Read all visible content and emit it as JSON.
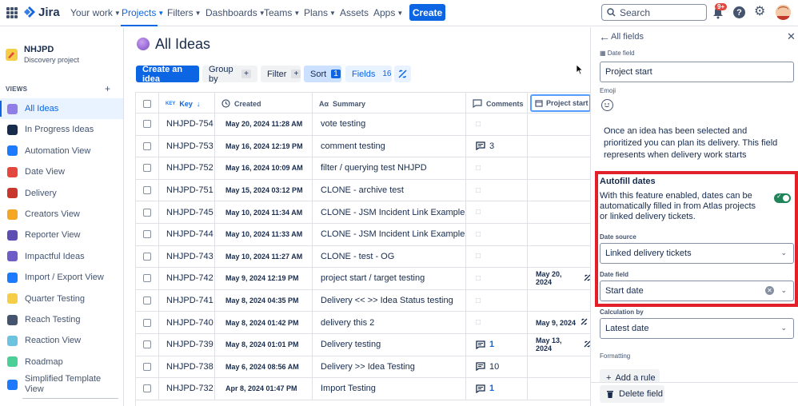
{
  "nav": {
    "logo_text": "Jira",
    "items": [
      "Your work",
      "Projects",
      "Filters",
      "Dashboards",
      "Teams",
      "Plans",
      "Assets",
      "Apps"
    ],
    "create_label": "Create",
    "search_placeholder": "Search",
    "notifications_badge": "9+",
    "help_label": "?"
  },
  "sidebar": {
    "project_name": "NHJPD",
    "project_type": "Discovery project",
    "views_title": "VIEWS",
    "views_add": "+",
    "items": [
      {
        "label": "All Ideas",
        "icon": "crystal-ball-icon",
        "color": "#8f7ee7"
      },
      {
        "label": "In Progress Ideas",
        "icon": "soon-sign-icon",
        "color": "#172b4d"
      },
      {
        "label": "Automation View",
        "icon": "infinity-icon",
        "color": "#1d7afc"
      },
      {
        "label": "Date View",
        "icon": "calendar-icon",
        "color": "#e2483d"
      },
      {
        "label": "Delivery",
        "icon": "truck-icon",
        "color": "#c9372c"
      },
      {
        "label": "Creators View",
        "icon": "person-icon",
        "color": "#f5a623"
      },
      {
        "label": "Reporter View",
        "icon": "pen-icon",
        "color": "#5e4db2"
      },
      {
        "label": "Impactful Ideas",
        "icon": "bar-chart-icon",
        "color": "#6e5dc6"
      },
      {
        "label": "Import / Export View",
        "icon": "arrows-icon",
        "color": "#1d7afc"
      },
      {
        "label": "Quarter Testing",
        "icon": "moon-icon",
        "color": "#f5cd47"
      },
      {
        "label": "Reach Testing",
        "icon": "telescope-icon",
        "color": "#44546f"
      },
      {
        "label": "Reaction View",
        "icon": "snowboard-icon",
        "color": "#6cc3e0"
      },
      {
        "label": "Roadmap",
        "icon": "map-icon",
        "color": "#4bce97"
      },
      {
        "label": "Simplified Template View",
        "icon": "globe-icon",
        "color": "#1d7afc"
      }
    ]
  },
  "main": {
    "title": "All Ideas",
    "toolbar": {
      "create_idea": "Create an idea",
      "group_by": "Group by",
      "group_by_count": "+",
      "filter": "Filter",
      "filter_count": "+",
      "sort": "Sort",
      "sort_count": "1",
      "fields": "Fields",
      "fields_count": "16"
    }
  },
  "table": {
    "headers": {
      "key": "Key",
      "created": "Created",
      "summary": "Summary",
      "comments": "Comments",
      "project_start": "Project start"
    },
    "rows": [
      {
        "key": "NHJPD-754",
        "created": "May 20, 2024 11:28 AM",
        "summary": "vote testing",
        "comments": "",
        "project_start": ""
      },
      {
        "key": "NHJPD-753",
        "created": "May 16, 2024 12:19 PM",
        "summary": "comment testing",
        "comments": "3",
        "project_start": ""
      },
      {
        "key": "NHJPD-752",
        "created": "May 16, 2024 10:09 AM",
        "summary": "filter / querying test NHJPD",
        "comments": "",
        "project_start": ""
      },
      {
        "key": "NHJPD-751",
        "created": "May 15, 2024 03:12 PM",
        "summary": "CLONE - archive test",
        "comments": "",
        "project_start": ""
      },
      {
        "key": "NHJPD-745",
        "created": "May 10, 2024 11:34 AM",
        "summary": "CLONE - JSM Incident Link Example",
        "comments": "",
        "project_start": ""
      },
      {
        "key": "NHJPD-744",
        "created": "May 10, 2024 11:33 AM",
        "summary": "CLONE - JSM Incident Link Example",
        "comments": "",
        "project_start": ""
      },
      {
        "key": "NHJPD-743",
        "created": "May 10, 2024 11:27 AM",
        "summary": "CLONE - test - OG",
        "comments": "",
        "project_start": ""
      },
      {
        "key": "NHJPD-742",
        "created": "May 9, 2024 12:19 PM",
        "summary": "project start / target testing",
        "comments": "",
        "project_start": "May 20, 2024"
      },
      {
        "key": "NHJPD-741",
        "created": "May 8, 2024 04:35 PM",
        "summary": "Delivery << >> Idea Status testing",
        "comments": "",
        "project_start": ""
      },
      {
        "key": "NHJPD-740",
        "created": "May 8, 2024 01:42 PM",
        "summary": "delivery this 2",
        "comments": "",
        "project_start": "May 9, 2024"
      },
      {
        "key": "NHJPD-739",
        "created": "May 8, 2024 01:01 PM",
        "summary": "Delivery testing",
        "comments": "1",
        "project_start": "May 13, 2024"
      },
      {
        "key": "NHJPD-738",
        "created": "May 6, 2024 08:56 AM",
        "summary": "Delivery >> Idea Testing",
        "comments": "10",
        "project_start": ""
      },
      {
        "key": "NHJPD-732",
        "created": "Apr 8, 2024 01:47 PM",
        "summary": "Import Testing",
        "comments": "1",
        "project_start": ""
      }
    ]
  },
  "panel": {
    "title": "All fields",
    "date_field_label": "Date field",
    "field_name_value": "Project start",
    "emoji_label": "Emoji",
    "description": "Once an idea has been selected and prioritized you can plan its delivery. This field represents when delivery work starts",
    "autofill_title": "Autofill dates",
    "autofill_text": "With this feature enabled, dates can be automatically filled in from Atlas projects or linked delivery tickets.",
    "date_source_label": "Date source",
    "date_source_value": "Linked delivery tickets",
    "date_field_label2": "Date field",
    "date_field_value": "Start date",
    "calculation_label": "Calculation by",
    "calculation_value": "Latest date",
    "formatting_label": "Formatting",
    "add_rule_label": "Add a rule",
    "delete_label": "Delete field",
    "highlight_color": "#e2202a"
  }
}
